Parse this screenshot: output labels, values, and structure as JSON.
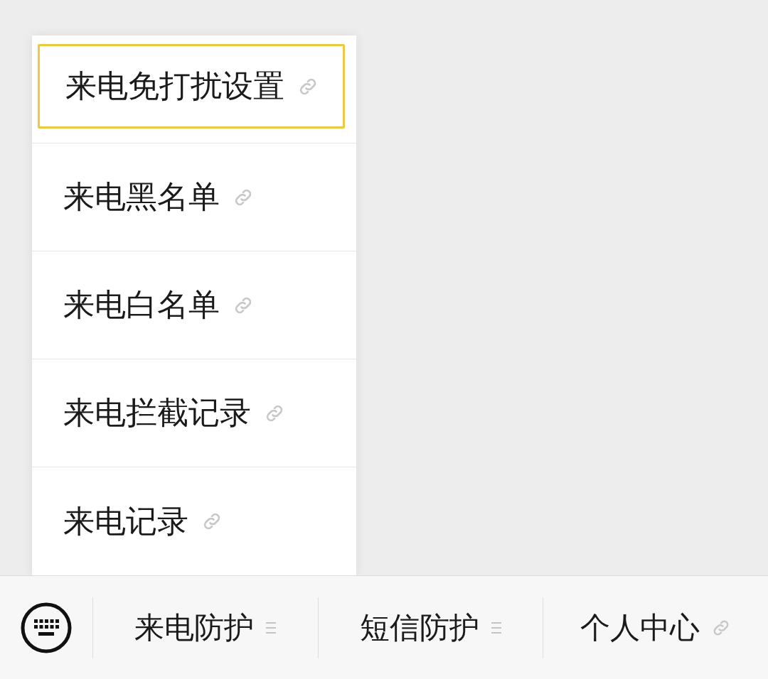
{
  "submenu": {
    "items": [
      {
        "label": "来电免打扰设置",
        "kind": "link",
        "selected": true
      },
      {
        "label": "来电黑名单",
        "kind": "link",
        "selected": false
      },
      {
        "label": "来电白名单",
        "kind": "link",
        "selected": false
      },
      {
        "label": "来电拦截记录",
        "kind": "link",
        "selected": false
      },
      {
        "label": "来电记录",
        "kind": "link",
        "selected": false
      }
    ]
  },
  "menu_bar": {
    "items": [
      {
        "label": "来电防护",
        "kind": "submenu"
      },
      {
        "label": "短信防护",
        "kind": "submenu"
      },
      {
        "label": "个人中心",
        "kind": "link"
      }
    ]
  }
}
